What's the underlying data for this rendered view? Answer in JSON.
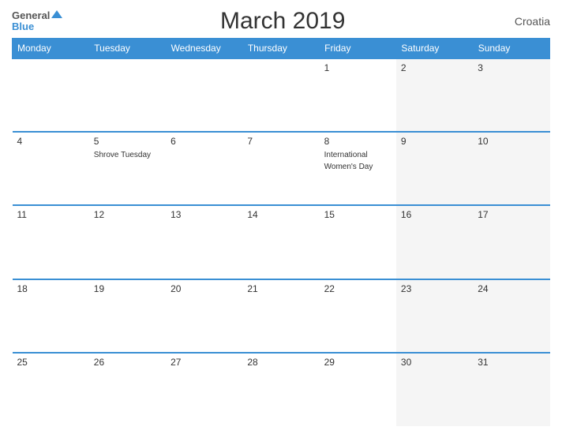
{
  "header": {
    "title": "March 2019",
    "country": "Croatia",
    "logo_general": "General",
    "logo_blue": "Blue"
  },
  "days_of_week": [
    "Monday",
    "Tuesday",
    "Wednesday",
    "Thursday",
    "Friday",
    "Saturday",
    "Sunday"
  ],
  "weeks": [
    [
      {
        "day": "",
        "event": ""
      },
      {
        "day": "",
        "event": ""
      },
      {
        "day": "",
        "event": ""
      },
      {
        "day": "",
        "event": ""
      },
      {
        "day": "1",
        "event": ""
      },
      {
        "day": "2",
        "event": ""
      },
      {
        "day": "3",
        "event": ""
      }
    ],
    [
      {
        "day": "4",
        "event": ""
      },
      {
        "day": "5",
        "event": "Shrove Tuesday"
      },
      {
        "day": "6",
        "event": ""
      },
      {
        "day": "7",
        "event": ""
      },
      {
        "day": "8",
        "event": "International Women's Day"
      },
      {
        "day": "9",
        "event": ""
      },
      {
        "day": "10",
        "event": ""
      }
    ],
    [
      {
        "day": "11",
        "event": ""
      },
      {
        "day": "12",
        "event": ""
      },
      {
        "day": "13",
        "event": ""
      },
      {
        "day": "14",
        "event": ""
      },
      {
        "day": "15",
        "event": ""
      },
      {
        "day": "16",
        "event": ""
      },
      {
        "day": "17",
        "event": ""
      }
    ],
    [
      {
        "day": "18",
        "event": ""
      },
      {
        "day": "19",
        "event": ""
      },
      {
        "day": "20",
        "event": ""
      },
      {
        "day": "21",
        "event": ""
      },
      {
        "day": "22",
        "event": ""
      },
      {
        "day": "23",
        "event": ""
      },
      {
        "day": "24",
        "event": ""
      }
    ],
    [
      {
        "day": "25",
        "event": ""
      },
      {
        "day": "26",
        "event": ""
      },
      {
        "day": "27",
        "event": ""
      },
      {
        "day": "28",
        "event": ""
      },
      {
        "day": "29",
        "event": ""
      },
      {
        "day": "30",
        "event": ""
      },
      {
        "day": "31",
        "event": ""
      }
    ]
  ],
  "colors": {
    "header_bg": "#3a8fd4",
    "border": "#3a8fd4",
    "weekend_bg": "#f5f5f5"
  }
}
